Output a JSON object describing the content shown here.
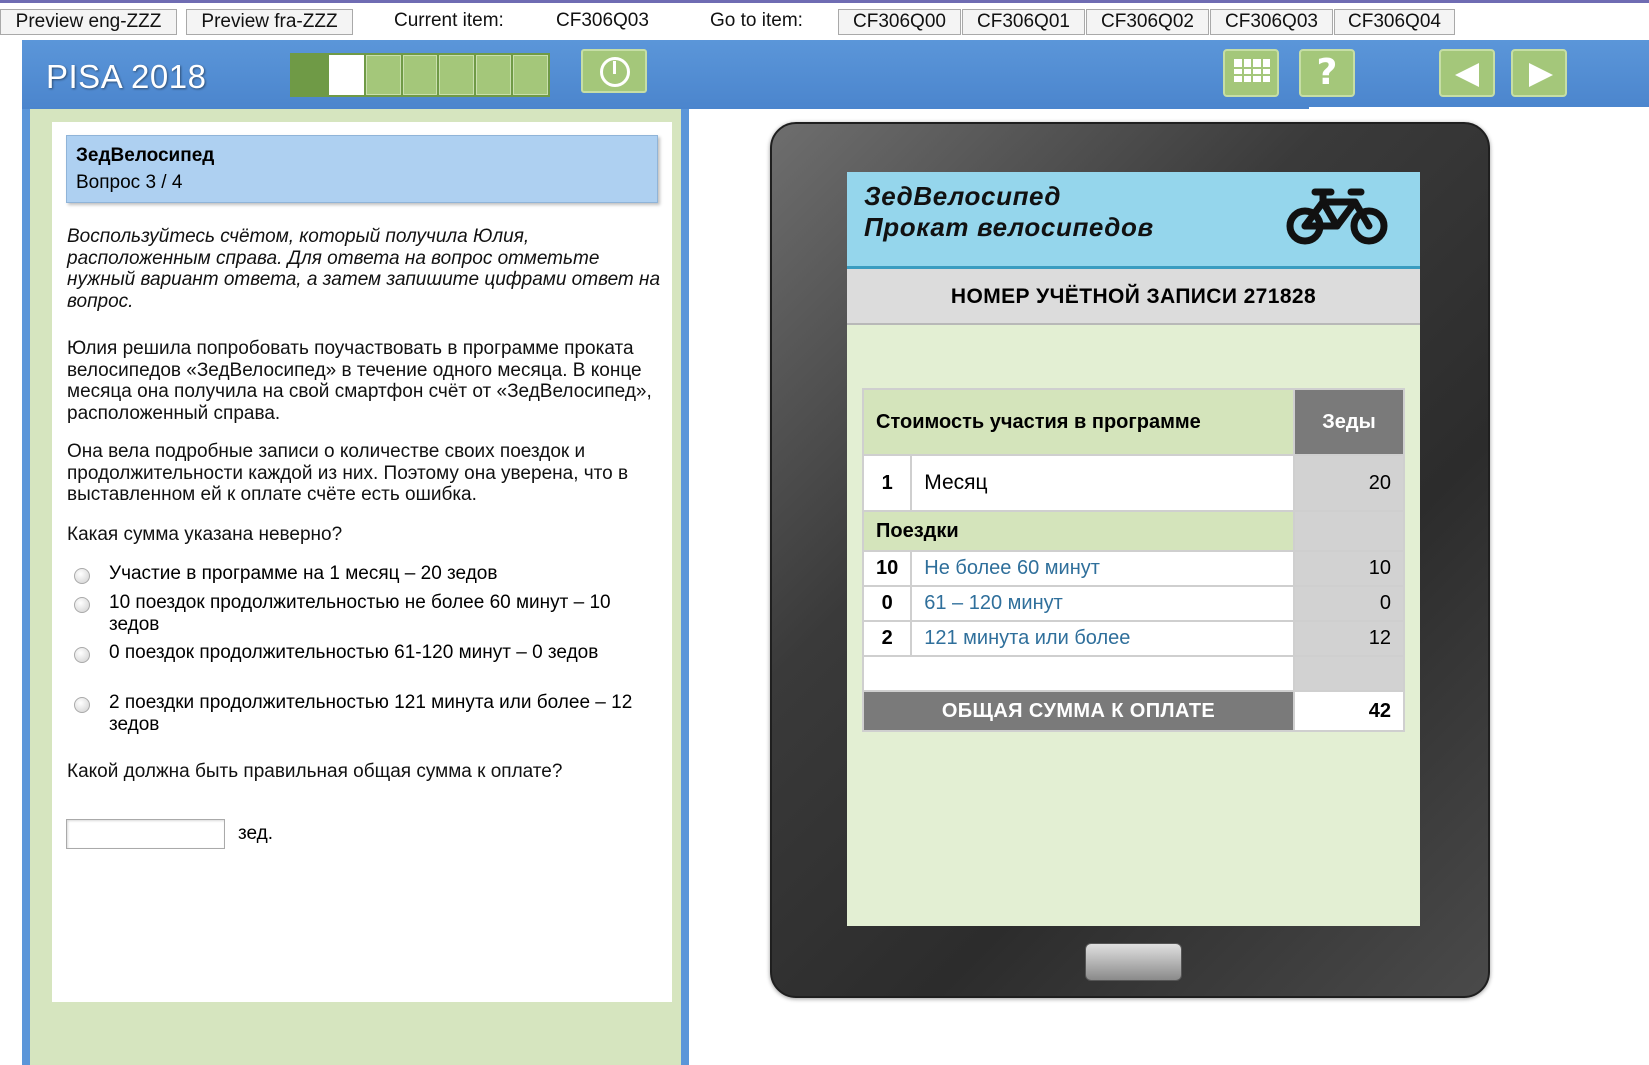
{
  "toolbar": {
    "preview_eng": "Preview eng-ZZZ",
    "preview_fra": "Preview fra-ZZZ",
    "current_item_label": "Current item:",
    "current_item": "CF306Q03",
    "goto_label": "Go to item:",
    "items": [
      "CF306Q00",
      "CF306Q01",
      "CF306Q02",
      "CF306Q03",
      "CF306Q04"
    ]
  },
  "header": {
    "brand": "PISA 2018",
    "progress": {
      "total": 7,
      "completed": 1,
      "current": 2
    },
    "icons": [
      "clock-icon",
      "calculator-icon",
      "help-icon",
      "back-arrow-icon",
      "next-arrow-icon"
    ],
    "help_glyph": "?",
    "colors": {
      "band": "#5b96d9",
      "button": "#a4c77a"
    }
  },
  "question": {
    "unit_title": "ЗедВелосипед",
    "number": "Вопрос 3 / 4",
    "instruction": "Воспользуйтесь счётом, который получила Юлия, расположенным справа. Для ответа на вопрос отметьте нужный вариант ответа, а затем запишите цифрами ответ на вопрос.",
    "para1": "Юлия решила попробовать поучаствовать в программе проката велосипедов «ЗедВелосипед» в течение одного месяца. В конце месяца она получила на свой смартфон счёт от «ЗедВелосипед», расположенный справа.",
    "para2": "Она вела подробные записи о количестве своих поездок и продолжительности каждой из них. Поэтому она уверена, что в выставленном ей к оплате счёте есть ошибка.",
    "prompt1": "Какая сумма указана неверно?",
    "options": [
      "Участие в программе на 1 месяц – 20 зедов",
      "10 поездок продолжительностью не более 60 минут – 10 зедов",
      "0 поездок продолжительностью 61-120 минут – 0 зедов",
      "2 поездки продолжительностью 121 минута или более – 12 зедов"
    ],
    "prompt2": "Какой должна быть правильная общая сумма к оплате?",
    "answer_value": "",
    "unit": "зед."
  },
  "phone": {
    "app_title_1": "ЗедВелосипед",
    "app_title_2": "Прокат велосипедов",
    "app_icon": "bicycle-icon",
    "account": "НОМЕР УЧЁТНОЙ ЗАПИСИ 271828",
    "bill": {
      "membership_header": "Стоимость участия в программе",
      "currency_header": "Зеды",
      "membership_qty": "1",
      "membership_label": "Месяц",
      "membership_cost": "20",
      "trips_header": "Поездки",
      "trips": [
        {
          "qty": "10",
          "label": "Не более 60 минут",
          "cost": "10"
        },
        {
          "qty": "0",
          "label": "61 – 120 минут",
          "cost": "0"
        },
        {
          "qty": "2",
          "label": "121 минута или более",
          "cost": "12"
        }
      ],
      "total_label": "ОБЩАЯ СУММА К ОПЛАТЕ",
      "total_value": "42"
    }
  }
}
